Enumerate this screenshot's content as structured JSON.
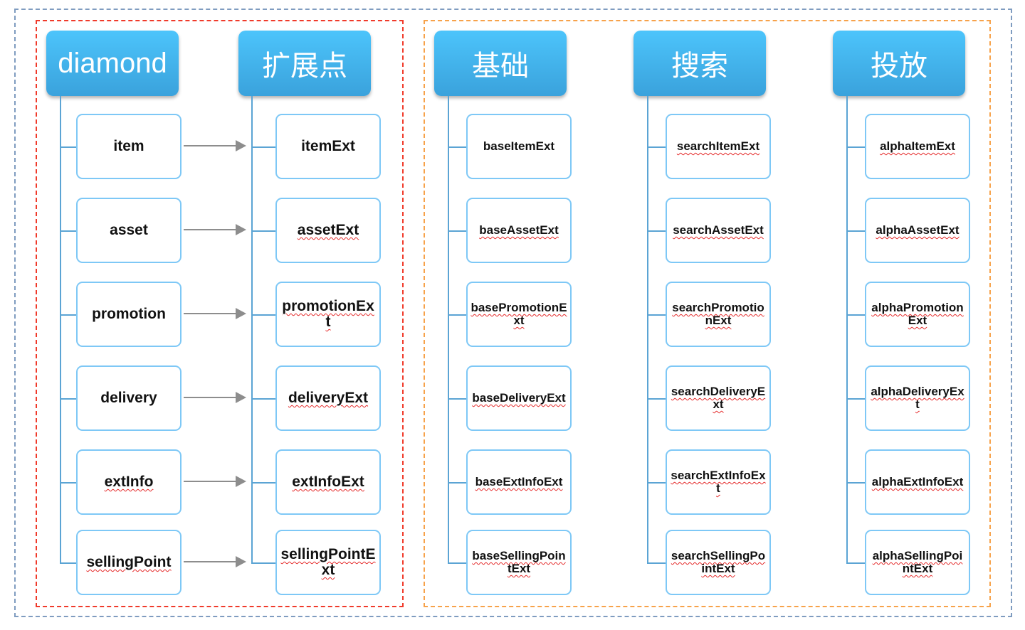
{
  "colors": {
    "header": "#3aa2dc",
    "box_border": "#7ec8f6",
    "red_group": "#f03a2a",
    "orange_group": "#f7a24a",
    "outer": "#7f9cc0"
  },
  "columns": [
    {
      "title": "diamond",
      "items": [
        {
          "label": "item",
          "misspelled": false
        },
        {
          "label": "asset",
          "misspelled": false
        },
        {
          "label": "promotion",
          "misspelled": false
        },
        {
          "label": "delivery",
          "misspelled": false
        },
        {
          "label": "extInfo",
          "misspelled": true
        },
        {
          "label": "sellingPoint",
          "misspelled": true
        }
      ]
    },
    {
      "title": "扩展点",
      "items": [
        {
          "label": "itemExt",
          "misspelled": false
        },
        {
          "label": "assetExt",
          "misspelled": true
        },
        {
          "label": "promotionExt",
          "misspelled": true
        },
        {
          "label": "deliveryExt",
          "misspelled": true
        },
        {
          "label": "extInfoExt",
          "misspelled": true
        },
        {
          "label": "sellingPointExt",
          "misspelled": true
        }
      ]
    },
    {
      "title": "基础",
      "items": [
        {
          "label": "baseItemExt",
          "misspelled": false
        },
        {
          "label": "baseAssetExt",
          "misspelled": true
        },
        {
          "label": "basePromotionExt",
          "misspelled": true
        },
        {
          "label": "baseDeliveryExt",
          "misspelled": true
        },
        {
          "label": "baseExtInfoExt",
          "misspelled": true
        },
        {
          "label": "baseSellingPointExt",
          "misspelled": true
        }
      ]
    },
    {
      "title": "搜索",
      "items": [
        {
          "label": "searchItemExt",
          "misspelled": true
        },
        {
          "label": "searchAssetExt",
          "misspelled": true
        },
        {
          "label": "searchPromotionExt",
          "misspelled": true
        },
        {
          "label": "searchDeliveryExt",
          "misspelled": true
        },
        {
          "label": "searchExtInfoExt",
          "misspelled": true
        },
        {
          "label": "searchSellingPointExt",
          "misspelled": true
        }
      ]
    },
    {
      "title": "投放",
      "items": [
        {
          "label": "alphaItemExt",
          "misspelled": true
        },
        {
          "label": "alphaAssetExt",
          "misspelled": true
        },
        {
          "label": "alphaPromotionExt",
          "misspelled": true
        },
        {
          "label": "alphaDeliveryExt",
          "misspelled": true
        },
        {
          "label": "alphaExtInfoExt",
          "misspelled": true
        },
        {
          "label": "alphaSellingPointExt",
          "misspelled": true
        }
      ]
    }
  ],
  "arrows": {
    "from": "diamond",
    "to": "扩展点"
  }
}
